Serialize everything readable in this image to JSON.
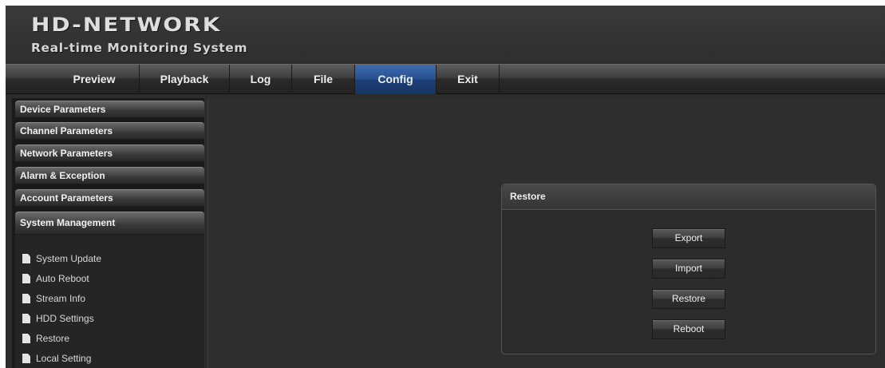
{
  "header": {
    "logo": "HD-NETWORK",
    "subtitle": "Real-time Monitoring System"
  },
  "nav": {
    "items": [
      {
        "label": "Preview"
      },
      {
        "label": "Playback"
      },
      {
        "label": "Log"
      },
      {
        "label": "File"
      },
      {
        "label": "Config",
        "active": true
      },
      {
        "label": "Exit"
      }
    ],
    "active_color": "#274f8f"
  },
  "sidebar": {
    "sections": [
      {
        "label": "Device Parameters"
      },
      {
        "label": "Channel Parameters"
      },
      {
        "label": "Network Parameters"
      },
      {
        "label": "Alarm & Exception"
      },
      {
        "label": "Account Parameters"
      },
      {
        "label": "System Management",
        "expanded": true
      }
    ],
    "sub_items": [
      {
        "label": "System Update",
        "icon": "document-icon"
      },
      {
        "label": "Auto Reboot",
        "icon": "document-icon"
      },
      {
        "label": "Stream Info",
        "icon": "document-icon"
      },
      {
        "label": "HDD Settings",
        "icon": "document-icon"
      },
      {
        "label": "Restore",
        "icon": "document-icon"
      },
      {
        "label": "Local Setting",
        "icon": "document-icon"
      }
    ]
  },
  "panel": {
    "title": "Restore",
    "buttons": {
      "export": "Export",
      "import": "Import",
      "restore": "Restore",
      "reboot": "Reboot"
    }
  }
}
